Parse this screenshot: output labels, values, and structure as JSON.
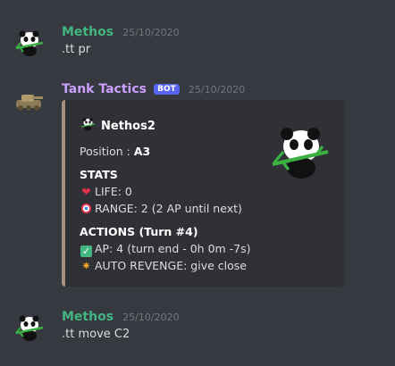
{
  "messages": [
    {
      "username": "Methos",
      "username_color": "#43b581",
      "timestamp": "25/10/2020",
      "text": ".tt pr"
    },
    {
      "username": "Tank Tactics",
      "username_color": "#c9a0ff",
      "badge": "BOT",
      "timestamp": "25/10/2020",
      "embed": {
        "accent_color": "#a5927e",
        "author": "Nethos2",
        "position_label": "Position : ",
        "position_value": "A3",
        "stats_title": "STATS",
        "life": "LIFE: 0",
        "range": "RANGE: 2 (2 AP until next)",
        "actions_title": "ACTIONS (Turn #4)",
        "ap": "AP: 4 (turn end - 0h 0m -7s)",
        "revenge": "AUTO REVENGE: give close",
        "icons": [
          "heart-icon",
          "target-icon",
          "check-icon",
          "explosion-icon"
        ]
      }
    },
    {
      "username": "Methos",
      "username_color": "#43b581",
      "timestamp": "25/10/2020",
      "text": ".tt move C2"
    }
  ]
}
